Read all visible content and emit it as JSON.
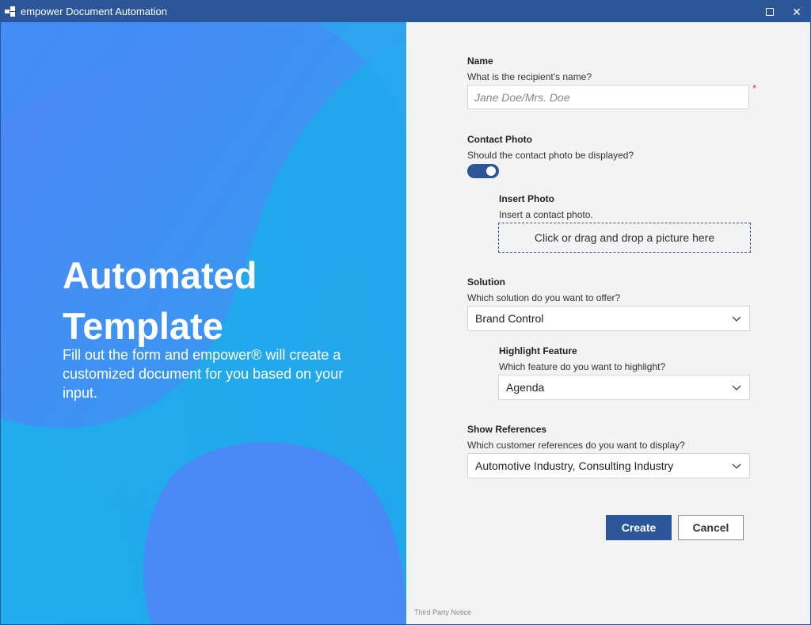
{
  "window": {
    "title": "empower Document Automation",
    "accent_color": "#2b579a"
  },
  "hero": {
    "title": "Automated Template",
    "description": "Fill out the form and empower® will create a customized document for you based on your input."
  },
  "form": {
    "name": {
      "label": "Name",
      "question": "What is the recipient's name?",
      "placeholder": "Jane Doe/Mrs. Doe",
      "required_mark": "*"
    },
    "contact_photo": {
      "label": "Contact Photo",
      "question": "Should the contact photo be displayed?",
      "enabled": true
    },
    "insert_photo": {
      "label": "Insert Photo",
      "question": "Insert a contact photo.",
      "dropzone_text": "Click or drag and drop a picture here"
    },
    "solution": {
      "label": "Solution",
      "question": "Which solution do you want to offer?",
      "value": "Brand Control"
    },
    "highlight_feature": {
      "label": "Highlight Feature",
      "question": "Which feature do you want to highlight?",
      "value": "Agenda"
    },
    "show_references": {
      "label": "Show References",
      "question": "Which customer references do you want to display?",
      "value": "Automotive Industry, Consulting Industry"
    },
    "create_label": "Create",
    "cancel_label": "Cancel",
    "third_party_notice": "Third Party Notice"
  }
}
